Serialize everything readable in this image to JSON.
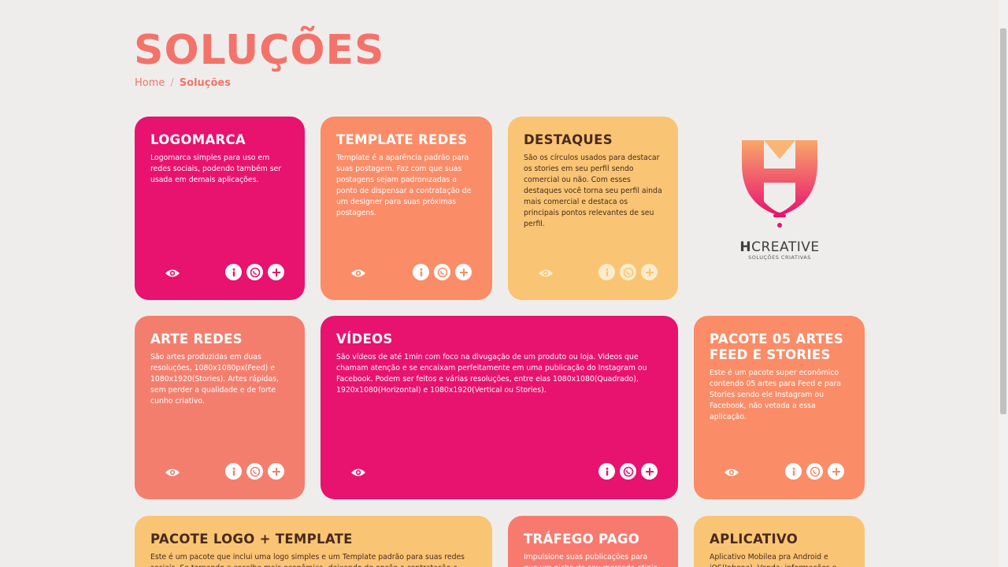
{
  "page": {
    "title": "SOLUÇÕES"
  },
  "breadcrumb": {
    "home": "Home",
    "separator": "/",
    "current": "Soluções"
  },
  "colors": {
    "pink": "#e8126f",
    "salmon": "#f47e6e",
    "orange": "#fa8c68",
    "yellow": "#f9c574",
    "coral": "#f87a6f",
    "title": "#f3736a"
  },
  "cards": [
    {
      "title": "LOGOMARCA",
      "text": "Logomarca simples para uso em redes sociais, podendo também ser usada em demais aplicações."
    },
    {
      "title": "TEMPLATE REDES",
      "text": "Template é a aparência padrão para suas postagem. Faz com que suas postagens sejam padronizadas a ponto de dispensar a contratação de um designer para suas próximas postagens."
    },
    {
      "title": "DESTAQUES",
      "text": "São os círculos usados para destacar os stories em seu perfil sendo comercial ou não. Com esses destaques você torna seu perfil ainda mais comercial e destaca os principais pontos relevantes de seu perfil."
    },
    {
      "title": "ARTE REDES",
      "text": "São artes produzidas em duas resoluções, 1080x1080px(Feed) e 1080x1920(Stories). Artes rápidas, sem perder a qualidade e de forte cunho criativo."
    },
    {
      "title": "VÍDEOS",
      "text": "São vídeos de até 1min com foco na divugação de um produto ou loja. Videos que chamam atenção e se encaixam perfeitamente em uma publicação do Instagram ou Facebook. Podem ser feitos e várias resoluções, entre elas 1080x1080(Quadrado), 1920x1080(Horizontal) e 1080x1920(Vertical ou Stories)."
    },
    {
      "title": "PACOTE 05 ARTES FEED E STORIES",
      "text": "Este é um pacote super econômico contendo 05 artes para Feed e para Stories sendo ele Instagram ou Facebook, não vetada a essa aplicação."
    },
    {
      "title": "PACOTE LOGO + TEMPLATE",
      "text": "Este é um pacote que inclui uma logo simples e um Template padrão para suas redes sociais. Se tornando a escolha mais econômica, deixando de opção a contratação a"
    },
    {
      "title": "TRÁFEGO PAGO",
      "text": "Impulsione suas publicações para que um nicho do seu mercado atinja"
    },
    {
      "title": "APLICATIVO",
      "text": "Aplicativo Mobilea pra Android e iOS(Iphone). Venda, informações e"
    }
  ],
  "logo": {
    "brand_bold": "H",
    "brand_rest": "CREATIVE",
    "tagline": "SOLUÇÕES CRIATIVAS"
  },
  "icons": {
    "view": "eye-icon",
    "info": "info-icon",
    "whatsapp": "whatsapp-icon",
    "add": "plus-icon"
  }
}
